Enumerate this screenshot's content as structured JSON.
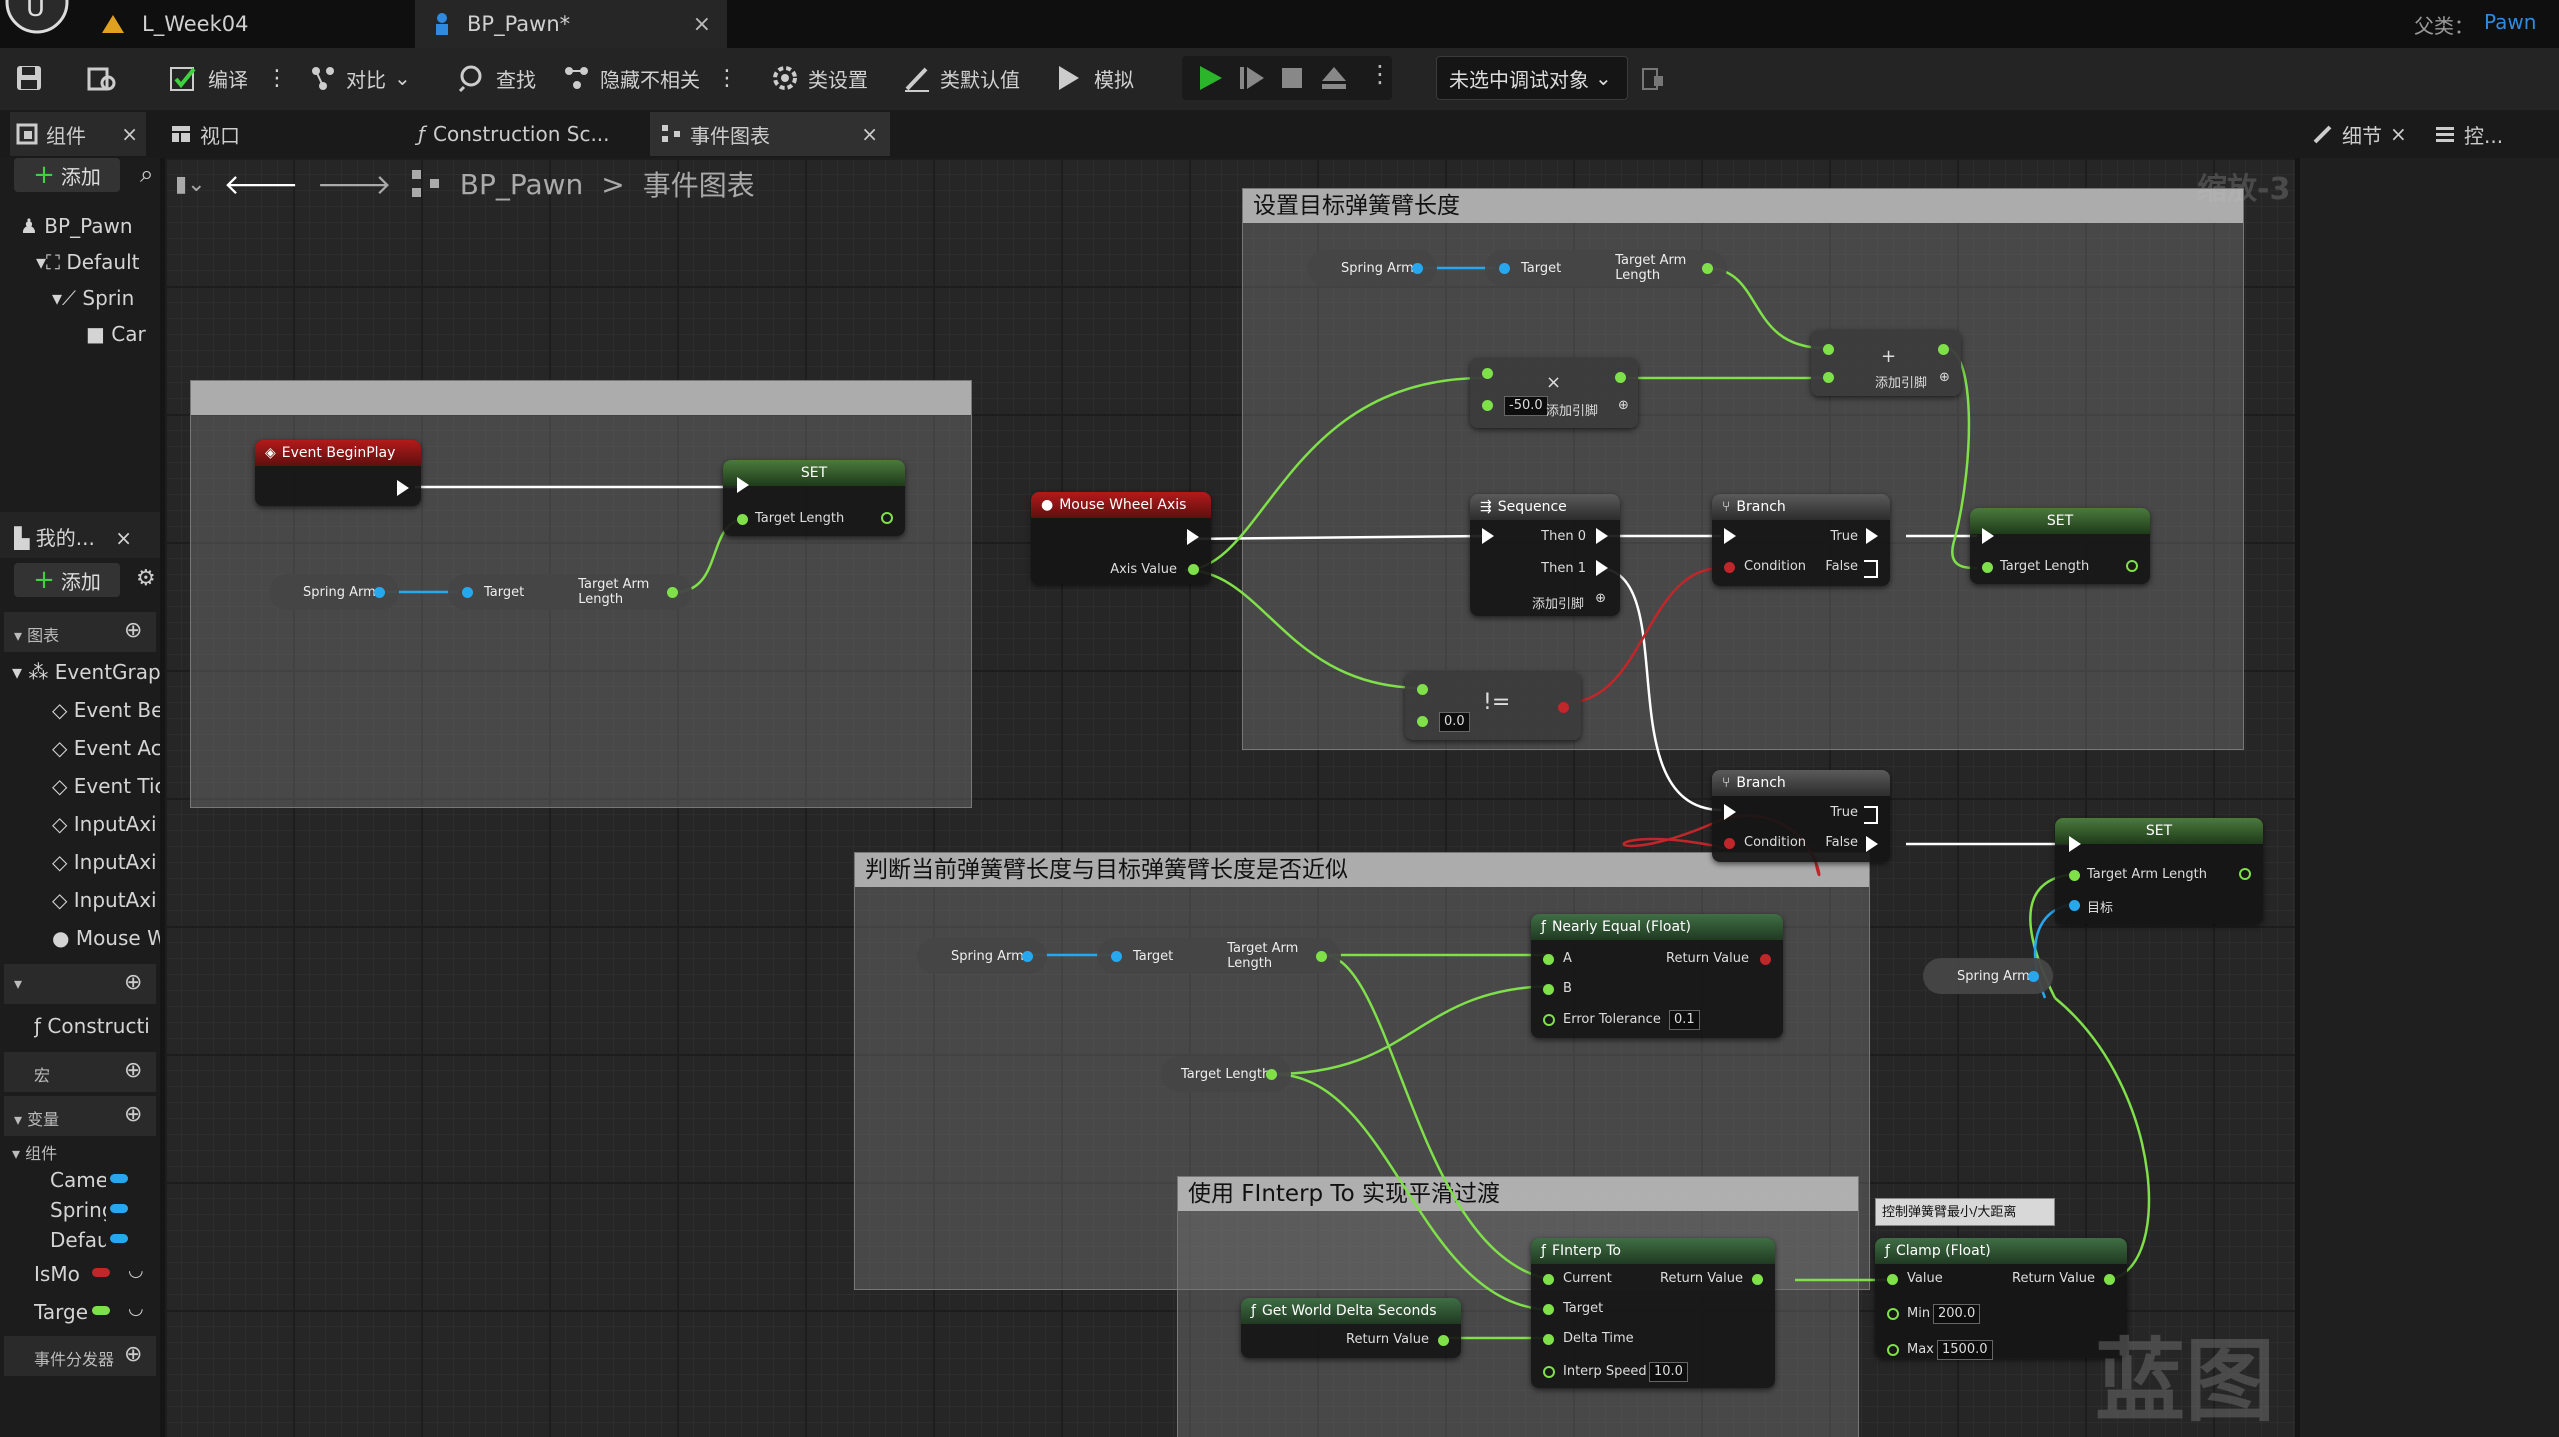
{
  "title_bar": {
    "tabs": [
      {
        "label": "L_Week04"
      },
      {
        "label": "BP_Pawn*"
      }
    ],
    "parent_label": "父类：",
    "parent_value": "Pawn"
  },
  "toolbar": {
    "compile": "编译",
    "diff": "对比",
    "find": "查找",
    "hide_unrelated": "隐藏不相关",
    "class_settings": "类设置",
    "class_defaults": "类默认值",
    "simulate": "模拟",
    "debug_target": "未选中调试对象"
  },
  "panel_tabs": {
    "components": "组件",
    "viewport": "视口",
    "construction": "Construction Sc...",
    "event_graph": "事件图表",
    "details": "细节",
    "controls": "控..."
  },
  "left_panel": {
    "add": "添加",
    "tree": [
      "BP_Pawn",
      "Default",
      "Sprin",
      "Car"
    ],
    "my_blueprint": "我的...",
    "add2": "添加",
    "graphs_header": "图表",
    "event_graph": "EventGrap",
    "events": [
      "Event Be",
      "Event Ac",
      "Event Tic",
      "InputAxi",
      "InputAxi",
      "InputAxi",
      "Mouse W"
    ],
    "construction": "Constructi",
    "macros": "宏",
    "variables": "变量",
    "components_group": "组件",
    "vars": [
      "Camer",
      "Spring",
      "Defau",
      "IsMo",
      "Targe"
    ],
    "dispatchers": "事件分发器"
  },
  "breadcrumb": {
    "root": "BP_Pawn",
    "sep": ">",
    "current": "事件图表",
    "zoom": "缩放-3"
  },
  "comments": {
    "top_right": "设置目标弹簧臂长度",
    "top_left": "",
    "middle": "判断当前弹簧臂长度与目标弹簧臂长度是否近似",
    "bottom": "使用 FInterp To 实现平滑过渡",
    "clamp_note": "控制弹簧臂最小/大距离"
  },
  "nodes": {
    "event_begin_play": "Event BeginPlay",
    "set": "SET",
    "target_length": "Target Length",
    "spring_arm": "Spring Arm",
    "target": "Target",
    "target_arm_length": "Target Arm Length",
    "mouse_wheel_axis": "Mouse Wheel Axis",
    "axis_value": "Axis Value",
    "sequence": "Sequence",
    "then0": "Then 0",
    "then1": "Then 1",
    "add_pin": "添加引脚",
    "branch": "Branch",
    "condition": "Condition",
    "true_label": "True",
    "false_label": "False",
    "multiply_value": "-50.0",
    "neq_value": "0.0",
    "nearly_equal": "Nearly Equal (Float)",
    "a": "A",
    "b": "B",
    "return_value": "Return Value",
    "error_tolerance": "Error Tolerance",
    "error_tolerance_value": "0.1",
    "target_cn": "目标",
    "finterp_to": "FInterp To",
    "current": "Current",
    "delta_time": "Delta Time",
    "interp_speed": "Interp Speed",
    "interp_speed_value": "10.0",
    "get_world_delta": "Get World Delta Seconds",
    "clamp": "Clamp (Float)",
    "value": "Value",
    "min": "Min",
    "min_value": "200.0",
    "max": "Max",
    "max_value": "1500.0"
  },
  "watermark": "蓝图",
  "colors": {
    "exec": "#ffffff",
    "float": "#7fe04a",
    "object": "#27a8ee",
    "bool": "#c0262a",
    "accent_blue": "#2f8be0",
    "play_green": "#2bb52b"
  }
}
